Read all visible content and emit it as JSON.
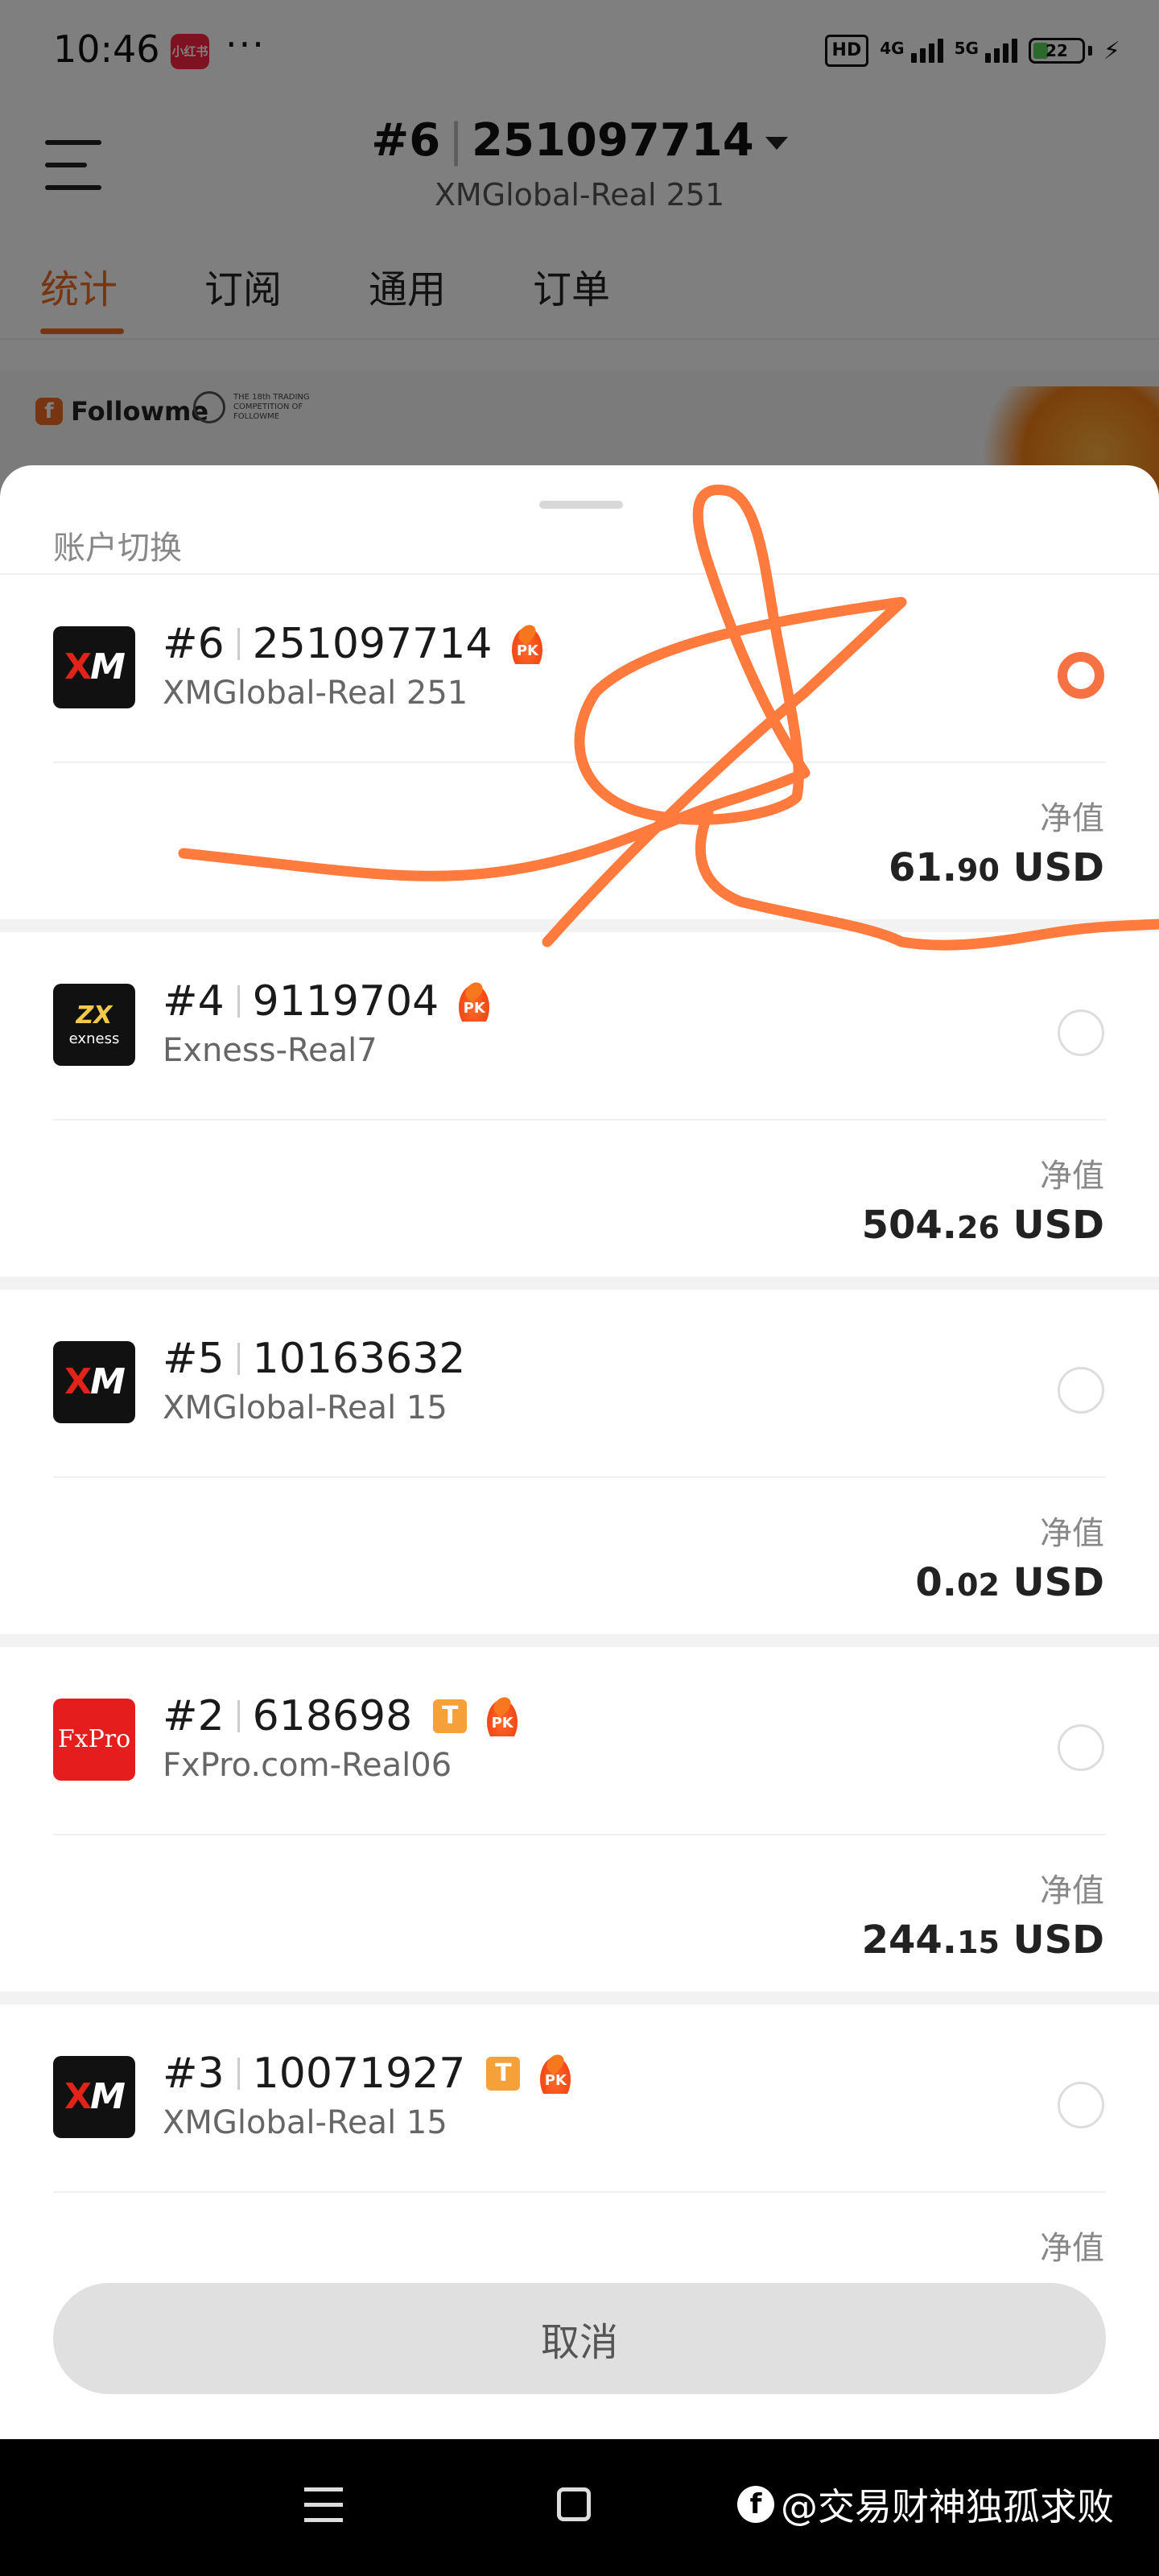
{
  "status_bar": {
    "time": "10:46",
    "app_badge": "小红书",
    "more": "···",
    "hd": "HD",
    "net1": "4G",
    "net2": "5G",
    "battery": "22"
  },
  "header": {
    "account_no": "#6",
    "account_id": "251097714",
    "server": "XMGlobal-Real 251"
  },
  "tabs": [
    {
      "label": "统计",
      "active": true
    },
    {
      "label": "订阅",
      "active": false
    },
    {
      "label": "通用",
      "active": false
    },
    {
      "label": "订单",
      "active": false
    }
  ],
  "banner": {
    "logo_text": "Followme",
    "competition_text": "THE 18th TRADING COMPETITION OF FOLLOWME"
  },
  "sheet": {
    "title": "账户切换",
    "net_value_label": "净值",
    "currency": "USD",
    "cancel_label": "取消"
  },
  "accounts": [
    {
      "no": "#6",
      "id": "251097714",
      "server": "XMGlobal-Real 251",
      "logo": "XM",
      "value_int": "61.",
      "value_dec": "90",
      "selected": true,
      "t_badge": false,
      "pk_badge": true
    },
    {
      "no": "#4",
      "id": "9119704",
      "server": "Exness-Real7",
      "logo": "exness",
      "value_int": "504.",
      "value_dec": "26",
      "selected": false,
      "t_badge": false,
      "pk_badge": true
    },
    {
      "no": "#5",
      "id": "10163632",
      "server": "XMGlobal-Real 15",
      "logo": "XM",
      "value_int": "0.",
      "value_dec": "02",
      "selected": false,
      "t_badge": false,
      "pk_badge": false
    },
    {
      "no": "#2",
      "id": "618698",
      "server": "FxPro.com-Real06",
      "logo": "FxPro",
      "value_int": "244.",
      "value_dec": "15",
      "selected": false,
      "t_badge": true,
      "pk_badge": true
    },
    {
      "no": "#3",
      "id": "10071927",
      "server": "XMGlobal-Real 15",
      "logo": "XM",
      "value_int": "",
      "value_dec": "",
      "selected": false,
      "t_badge": true,
      "pk_badge": true
    }
  ],
  "badges": {
    "t": "T",
    "pk": "PK"
  },
  "logos": {
    "xm_x": "X",
    "xm_m": "M",
    "exness_mark": "ZX",
    "exness_name": "exness",
    "fxpro": "FxPro"
  },
  "watermark": "@交易财神独孤求败",
  "colors": {
    "accent": "#f06b22",
    "radio_on": "#f77243",
    "scribble": "#ff7a3d"
  }
}
